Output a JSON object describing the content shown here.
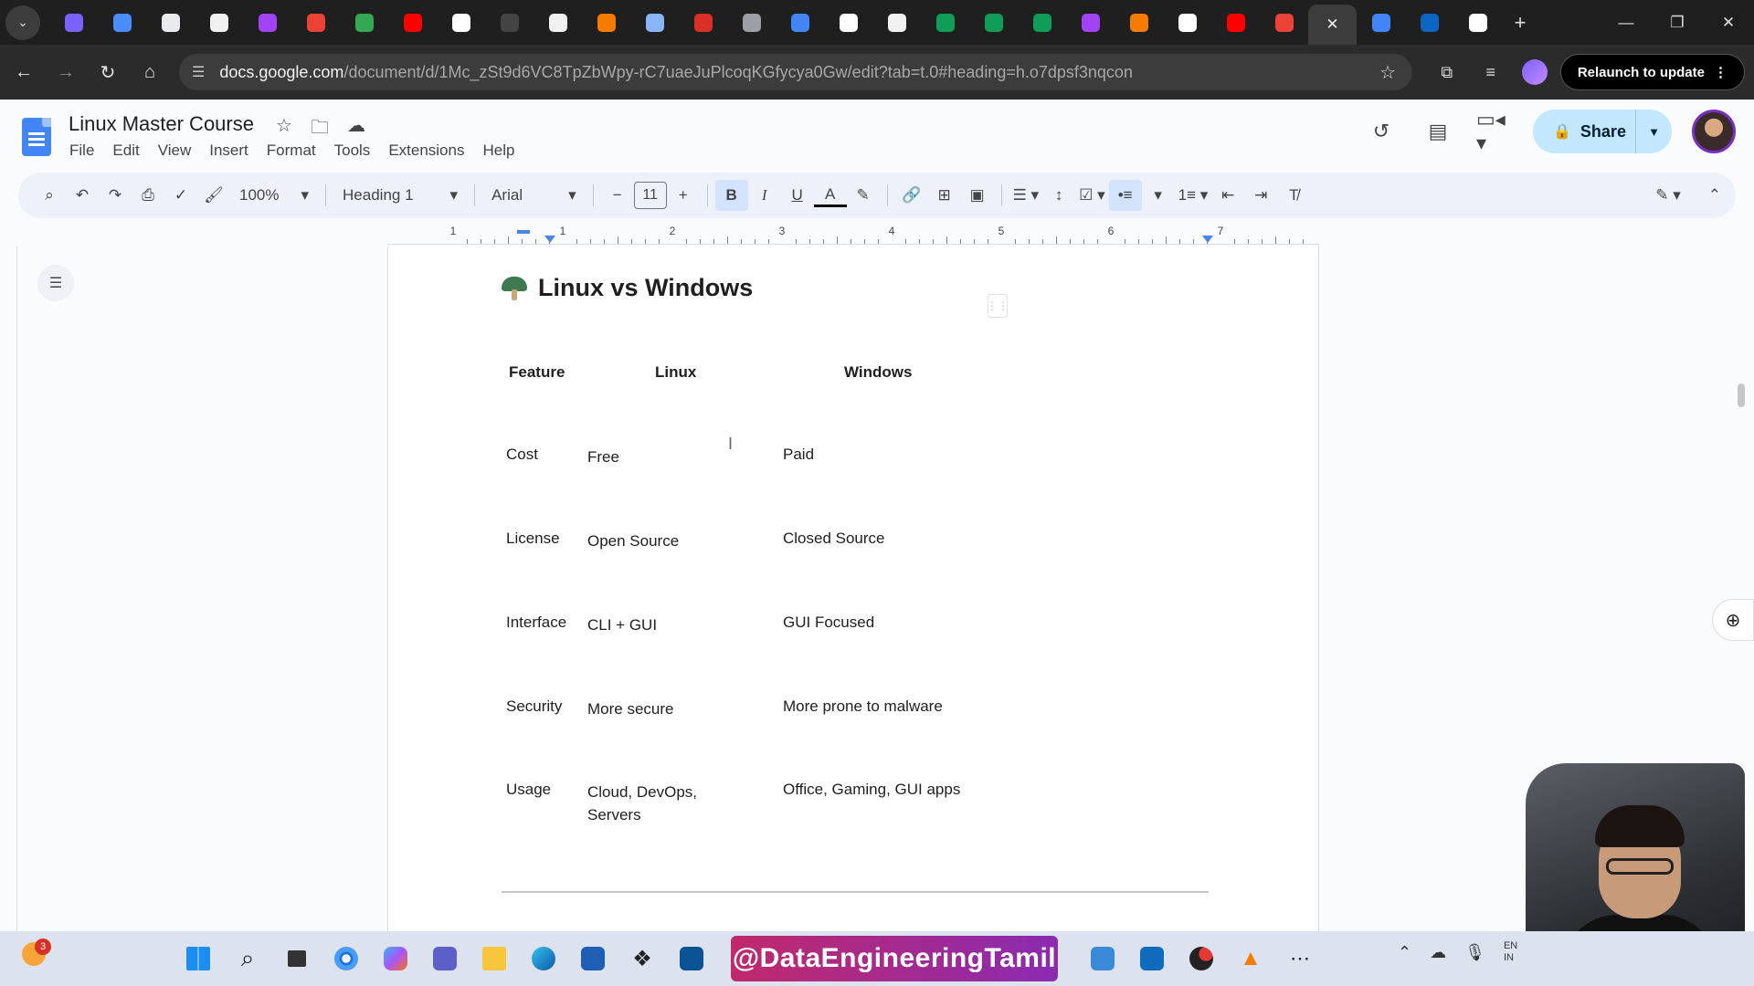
{
  "browser": {
    "url_host": "docs.google.com",
    "url_path": "/document/d/1Mc_zSt9d6VC8TpZbWpy-rC7uaeJuPlcoqKGfycya0Gw/edit?tab=t.0#heading=h.o7dpsf3nqcon",
    "relaunch_label": "Relaunch to update",
    "tab_favicon_colors": [
      "#7b61ff",
      "#4a8df8",
      "#e8eaed",
      "#f1f1f1",
      "#a142f4",
      "#ea4335",
      "#34a853",
      "#ff0000",
      "#ffffff",
      "#444444",
      "#f1f1f1",
      "#f57c00",
      "#8ab4f8",
      "#d93025",
      "#9aa0a6",
      "#4285f4",
      "#ffffff",
      "#f1f1f1",
      "#0f9d58",
      "#0f9d58",
      "#0f9d58",
      "#a142f4",
      "#f57c00",
      "#ffffff",
      "#ff0000",
      "#ea4335"
    ],
    "tab_after_active_colors": [
      "#4285f4",
      "#0a66c2",
      "#ffffff"
    ]
  },
  "docs": {
    "title": "Linux Master Course",
    "menu": [
      "File",
      "Edit",
      "View",
      "Insert",
      "Format",
      "Tools",
      "Extensions",
      "Help"
    ],
    "share_label": "Share",
    "toolbar": {
      "zoom": "100%",
      "style": "Heading 1",
      "font": "Arial",
      "font_size": "11"
    },
    "ruler_numbers": [
      "1",
      "1",
      "2",
      "3",
      "4",
      "5",
      "6",
      "7"
    ]
  },
  "document": {
    "heading": "Linux vs Windows",
    "table": {
      "headers": [
        "Feature",
        "Linux",
        "Windows"
      ],
      "rows": [
        {
          "feature": "Cost",
          "linux": "Free",
          "windows": "Paid"
        },
        {
          "feature": "License",
          "linux": "Open Source",
          "windows": "Closed Source"
        },
        {
          "feature": "Interface",
          "linux": "CLI + GUI",
          "windows": "GUI Focused"
        },
        {
          "feature": "Security",
          "linux": "More secure",
          "windows": "More prone to malware"
        },
        {
          "feature": "Usage",
          "linux": "Cloud, DevOps, Servers",
          "windows": "Office, Gaming, GUI apps"
        }
      ]
    }
  },
  "taskbar": {
    "weather_badge": "3",
    "brand_banner": "@DataEngineeringTamil",
    "lang_line1": "EN",
    "lang_line2": "IN"
  },
  "colors": {
    "accent": "#1a73e8",
    "share_bg": "#c2e7ff",
    "toolbar_bg": "#edf2fa"
  }
}
